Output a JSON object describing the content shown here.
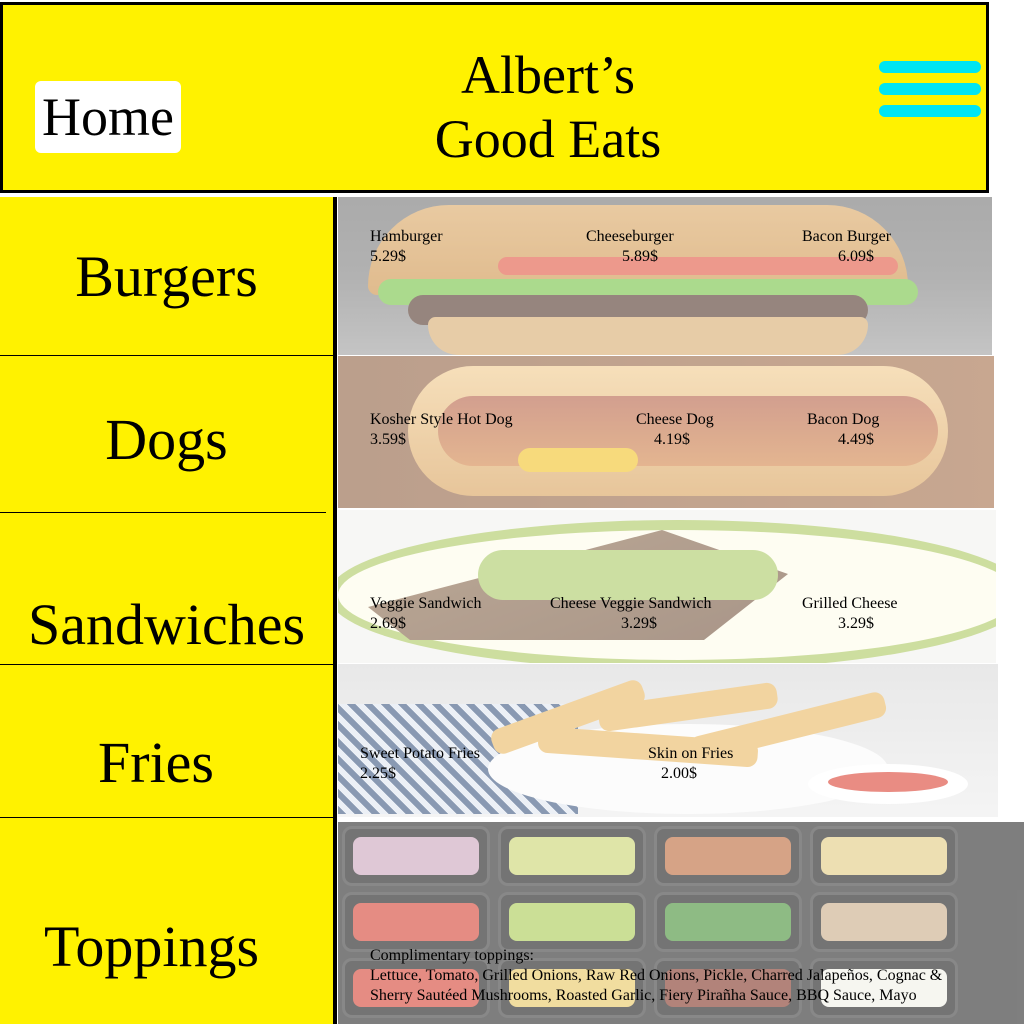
{
  "header": {
    "home_label": "Home",
    "title_line1": "Albert’s",
    "title_line2": "Good Eats",
    "menu_icon": "hamburger-menu-icon"
  },
  "sidebar": {
    "items": [
      {
        "label": "Burgers"
      },
      {
        "label": "Dogs"
      },
      {
        "label": "Sandwiches"
      },
      {
        "label": "Fries"
      },
      {
        "label": "Toppings"
      }
    ]
  },
  "menu": {
    "burgers": [
      {
        "name": "Hamburger",
        "price": "5.29$"
      },
      {
        "name": "Cheeseburger",
        "price": "5.89$"
      },
      {
        "name": "Bacon Burger",
        "price": "6.09$"
      }
    ],
    "dogs": [
      {
        "name": "Kosher Style Hot Dog",
        "price": "3.59$"
      },
      {
        "name": "Cheese Dog",
        "price": "4.19$"
      },
      {
        "name": "Bacon Dog",
        "price": "4.49$"
      }
    ],
    "sandwiches": [
      {
        "name": "Veggie Sandwich",
        "price": "2.69$"
      },
      {
        "name": "Cheese Veggie Sandwich",
        "price": "3.29$"
      },
      {
        "name": "Grilled Cheese",
        "price": "3.29$"
      }
    ],
    "fries": [
      {
        "name": "Sweet Potato Fries",
        "price": "2.25$"
      },
      {
        "name": "Skin on Fries",
        "price": "2.00$"
      }
    ],
    "toppings": {
      "heading": "Complimentary toppings:",
      "line1": "Lettuce, Tomato, Grilled Onions, Raw Red Onions, Pickle, Charred Jalapeños, Cognac &",
      "line2": "Sherry Sautéed Mushrooms, Roasted Garlic, Fiery Pirañha Sauce, BBQ Sauce, Mayo"
    }
  },
  "colors": {
    "accent": "#fff200",
    "menu_icon": "#00e5f2",
    "border": "#000000"
  }
}
